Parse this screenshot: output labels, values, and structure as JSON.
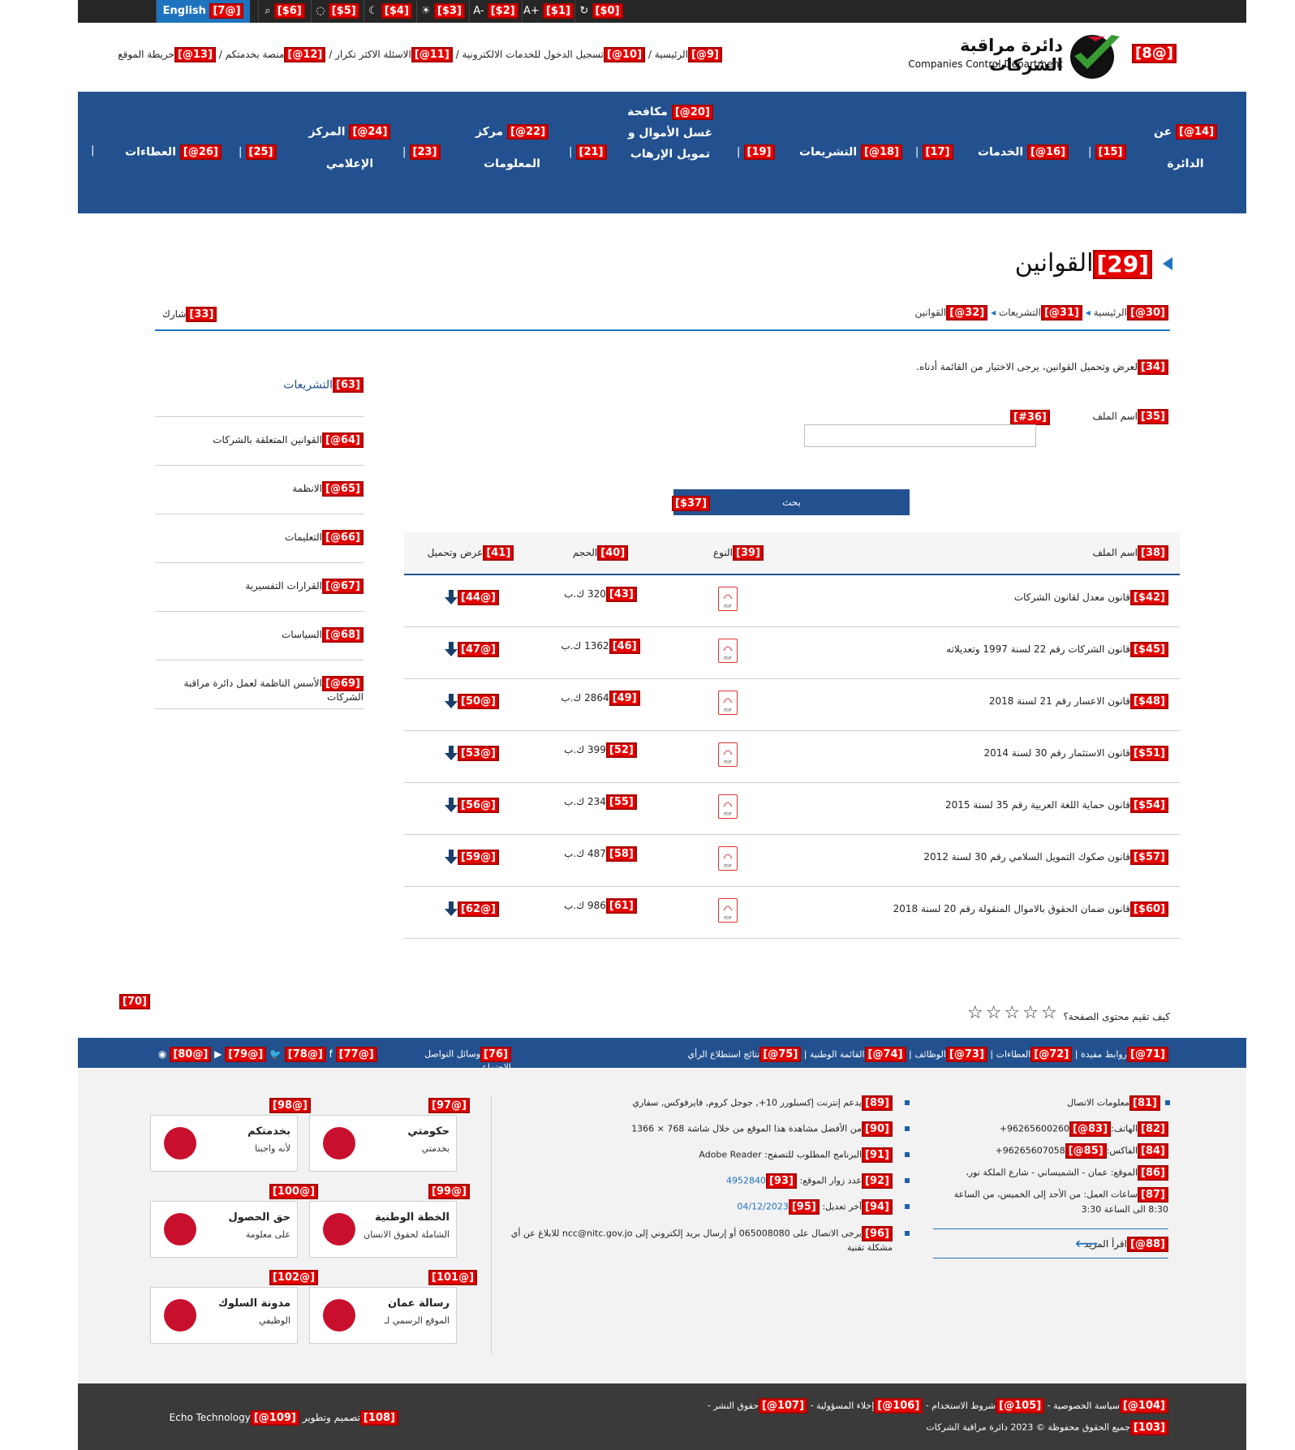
{
  "topbar": {
    "english": "English",
    "english_tag": "[7@]",
    "tools": [
      {
        "icon": "search-icon",
        "tag": "[$6]"
      },
      {
        "icon": "eye-slash-icon",
        "tag": "[$5]"
      },
      {
        "icon": "moon-icon",
        "tag": "[$4]"
      },
      {
        "icon": "sun-icon",
        "tag": "[$3]"
      },
      {
        "icon": "font-decrease-icon",
        "tag": "[$2]",
        "glyph": "A-"
      },
      {
        "icon": "font-increase-icon",
        "tag": "[$1]",
        "glyph": "A+"
      },
      {
        "icon": "reset-icon",
        "tag": "[$0]"
      }
    ]
  },
  "header": {
    "logo_tag": "[8@]",
    "logo_ar": "دائرة مراقبة الشركات",
    "logo_en": "Companies Control Department",
    "links": [
      {
        "tag": "[9@]",
        "label": "الرئيسية"
      },
      {
        "tag": "[10@]",
        "label": "تسجيل الدخول للخدمات الالكترونية"
      },
      {
        "tag": "[11@]",
        "label": "الاسئلة الاكثر تكرار"
      },
      {
        "tag": "[12@]",
        "label": "منصة بخدمتكم"
      },
      {
        "tag": "[13@]",
        "label": "خريطة الموقع"
      }
    ]
  },
  "nav": {
    "items": [
      {
        "tag": "[14@]",
        "line1": "عن",
        "line2": "الدائرة"
      },
      {
        "tag": "[15]"
      },
      {
        "tag": "[16@]",
        "line1": "الخدمات"
      },
      {
        "tag": "[17]"
      },
      {
        "tag": "[18@]",
        "line1": "التشريعات"
      },
      {
        "tag": "[19]"
      },
      {
        "tag": "[20@]",
        "line1": "مكافحة",
        "line2": "غسل الأموال و",
        "line3": "تمويل الإرهاب"
      },
      {
        "tag": "[21]"
      },
      {
        "tag": "[22@]",
        "line1": "مركز",
        "line2": "المعلومات"
      },
      {
        "tag": "[23]"
      },
      {
        "tag": "[24@]",
        "line1": "المركز",
        "line2": "الإعلامي"
      },
      {
        "tag": "[25]"
      },
      {
        "tag": "[26@]",
        "line1": "العطاءات"
      }
    ]
  },
  "page": {
    "title_tag": "[29]",
    "title": "القوانين",
    "breadcrumb": [
      {
        "tag": "[30@]",
        "label": "الرئيسية"
      },
      {
        "tag": "[31@]",
        "label": "التشريعات"
      },
      {
        "tag": "[32@]",
        "label": "القوانين"
      }
    ],
    "share_tag": "[33]",
    "share": "شارك",
    "intro_tag": "[34]",
    "intro": "لعرض وتحميل القوانين، يرجى الاختيار من القائمة أدناه.",
    "filename_label_tag": "[35]",
    "filename_label": "اسم الملف",
    "filename_input_tag": "[#36]",
    "filename_value": "",
    "search_tag": "[$37]",
    "search_label": "بحث"
  },
  "table": {
    "headers": [
      {
        "tag": "[38]",
        "label": "اسم الملف"
      },
      {
        "tag": "[39]",
        "label": "النوع"
      },
      {
        "tag": "[40]",
        "label": "الحجم"
      },
      {
        "tag": "[41]",
        "label": "عرض وتحميل"
      }
    ],
    "rows": [
      {
        "name_tag": "[$42]",
        "name": "قانون معدل لقانون الشركات",
        "size_tag": "[43]",
        "size": "320 ك.ب",
        "dl_tag": "[44@]"
      },
      {
        "name_tag": "[$45]",
        "name": "قانون الشركات رقم 22 لسنة 1997 وتعديلاته",
        "size_tag": "[46]",
        "size": "1362 ك.ب",
        "dl_tag": "[47@]"
      },
      {
        "name_tag": "[$48]",
        "name": "قانون الاعسار رقم 21 لسنة 2018",
        "size_tag": "[49]",
        "size": "2864 ك.ب",
        "dl_tag": "[50@]"
      },
      {
        "name_tag": "[$51]",
        "name": "قانون الاستثمار رقم 30 لسنة 2014",
        "size_tag": "[52]",
        "size": "399 ك.ب",
        "dl_tag": "[53@]"
      },
      {
        "name_tag": "[$54]",
        "name": "قانون حماية اللغة العربية رقم 35 لسنة 2015",
        "size_tag": "[55]",
        "size": "234 ك.ب",
        "dl_tag": "[56@]"
      },
      {
        "name_tag": "[$57]",
        "name": "قانون صكوك التمويل السلامي رقم 30 لسنة 2012",
        "size_tag": "[58]",
        "size": "487 ك.ب",
        "dl_tag": "[59@]"
      },
      {
        "name_tag": "[$60]",
        "name": "قانون ضمان الحقوق بالاموال المنقولة رقم 20 لسنة 2018",
        "size_tag": "[61]",
        "size": "986 ك.ب",
        "dl_tag": "[62@]"
      }
    ],
    "pdf_label": "PDF"
  },
  "sidebar": {
    "title_tag": "[63]",
    "title": "التشريعات",
    "items": [
      {
        "tag": "[64@]",
        "label": "القوانين المتعلقة بالشركات"
      },
      {
        "tag": "[65@]",
        "label": "الانظمة"
      },
      {
        "tag": "[66@]",
        "label": "التعليمات"
      },
      {
        "tag": "[67@]",
        "label": "القرارات التفسيرية"
      },
      {
        "tag": "[68@]",
        "label": "السياسات"
      },
      {
        "tag": "[69@]",
        "label": "الأسس الناظمة لعمل دائرة مراقبة الشركات"
      }
    ]
  },
  "rating": {
    "tag70": "[70]",
    "label": "كيف تقيم محتوى الصفحة؟",
    "stars": 5
  },
  "footer_bar": {
    "links": [
      {
        "tag": "[71@]",
        "label": "روابط مفيدة"
      },
      {
        "tag": "[72@]",
        "label": "العطاءات"
      },
      {
        "tag": "[73@]",
        "label": "الوظائف"
      },
      {
        "tag": "[74@]",
        "label": "القائمة الوطنية"
      },
      {
        "tag": "[75@]",
        "label": "نتائج استطلاع الرأي"
      }
    ],
    "social_tag": "[76]",
    "social_label": "وسائل التواصل الاجتماعي",
    "social": [
      {
        "tag": "[77@]",
        "icon": "facebook-icon",
        "glyph": "f"
      },
      {
        "tag": "[78@]",
        "icon": "twitter-icon",
        "glyph": "🐦"
      },
      {
        "tag": "[79@]",
        "icon": "youtube-icon",
        "glyph": "▶"
      },
      {
        "tag": "[80@]",
        "icon": "rss-icon",
        "glyph": "◉"
      }
    ]
  },
  "contact": {
    "title_tag": "[81]",
    "title": "معلومات الاتصال",
    "phone_tag": "[82]",
    "phone_label": "الهاتف:",
    "phone_link_tag": "[83@]",
    "phone": "+96265600260",
    "fax_tag": "[84]",
    "fax_label": "الفاكس:",
    "fax_link_tag": "[85@]",
    "fax": "+96265607058",
    "address_tag": "[86]",
    "address": "الموقع: عمان - الشميساني - شارع الملكة نور،",
    "hours_tag": "[87]",
    "hours": "ساعات العمل: من الأحد إلى الخميس، من الساعة 8:30 الى الساعة 3:30",
    "more_tag": "[88@]",
    "more": "اقرأ المزيد"
  },
  "siteinfo": {
    "items": [
      {
        "tag": "[89]",
        "text": "يدعم إنترنت إكسبلورر 10+, جوجل كروم, فايرفوكس, سفاري"
      },
      {
        "tag": "[90]",
        "text": "من الأفضل مشاهدة هذا الموقع من خلال شاشة 768 × 1366"
      },
      {
        "tag": "[91]",
        "text": "البرنامج المطلوب للتصفح: Adobe Reader"
      },
      {
        "tag": "[92]",
        "text": "عدد زوار الموقع:",
        "link_tag": "[93]",
        "link": "4952840"
      },
      {
        "tag": "[94]",
        "text": "آخر تعديل:",
        "link_tag": "[95]",
        "link": "04/12/2023"
      },
      {
        "tag": "[96]",
        "text": "يرجى الاتصال على 065008080 أو إرسال بريد إلكتروني إلى ncc@nitc.gov.jo للابلاغ عن أي مشكلة تقنية"
      }
    ]
  },
  "partners": [
    {
      "tag": "[97@]",
      "line1": "حكومتي",
      "line2": "بخدمتي",
      "icon": "hukumati-logo"
    },
    {
      "tag": "[98@]",
      "line1": "بخدمتكم",
      "line2": "لأنه واجبنا",
      "icon": "bikhedmetkom-logo"
    },
    {
      "tag": "[99@]",
      "line1": "الخطة الوطنية",
      "line2": "الشاملة لحقوق الانسان",
      "icon": "human-rights-logo"
    },
    {
      "tag": "[100@]",
      "line1": "حق الحصول",
      "line2": "على معلومة",
      "icon": "info-access-logo"
    },
    {
      "tag": "[101@]",
      "line1": "رسالة عمان",
      "line2": "الموقع الرسمي لـ",
      "icon": "amman-message-logo"
    },
    {
      "tag": "[102@]",
      "line1": "مدونة السلوك",
      "line2": "الوظيفي",
      "icon": "code-of-conduct-logo"
    }
  ],
  "bottom": {
    "links": [
      {
        "tag": "[104@]",
        "label": "سياسة الخصوصية"
      },
      {
        "tag": "[105@]",
        "label": "شروط الاستخدام"
      },
      {
        "tag": "[106@]",
        "label": "إخلاء المسؤولية"
      },
      {
        "tag": "[107@]",
        "label": "حقوق النشر"
      }
    ],
    "copyright_tag": "[103]",
    "copyright": "جميع الحقوق محفوظة © 2023 دائرة مراقبة الشركات",
    "design_tag": "[108]",
    "design": "تصميم وتطوير",
    "dev_tag": "[109@]",
    "dev": "Echo Technology"
  }
}
